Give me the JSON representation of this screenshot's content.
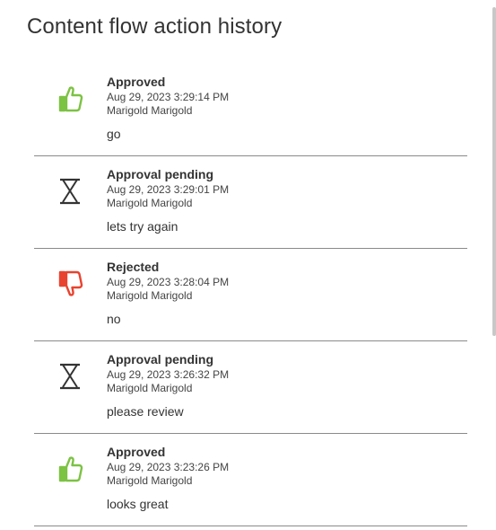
{
  "page": {
    "title": "Content flow action history"
  },
  "colors": {
    "approved": "#7cc243",
    "rejected": "#e8432f",
    "pending": "#333333",
    "divider": "#8a8a8a"
  },
  "entries": [
    {
      "status": "Approved",
      "icon": "thumbs-up-icon",
      "timestamp": "Aug 29, 2023 3:29:14 PM",
      "user": "Marigold Marigold",
      "comment": "go"
    },
    {
      "status": "Approval pending",
      "icon": "hourglass-icon",
      "timestamp": "Aug 29, 2023 3:29:01 PM",
      "user": "Marigold Marigold",
      "comment": "lets try again"
    },
    {
      "status": "Rejected",
      "icon": "thumbs-down-icon",
      "timestamp": "Aug 29, 2023 3:28:04 PM",
      "user": "Marigold Marigold",
      "comment": "no"
    },
    {
      "status": "Approval pending",
      "icon": "hourglass-icon",
      "timestamp": "Aug 29, 2023 3:26:32 PM",
      "user": "Marigold Marigold",
      "comment": "please review"
    },
    {
      "status": "Approved",
      "icon": "thumbs-up-icon",
      "timestamp": "Aug 29, 2023 3:23:26 PM",
      "user": "Marigold Marigold",
      "comment": "looks great"
    }
  ]
}
